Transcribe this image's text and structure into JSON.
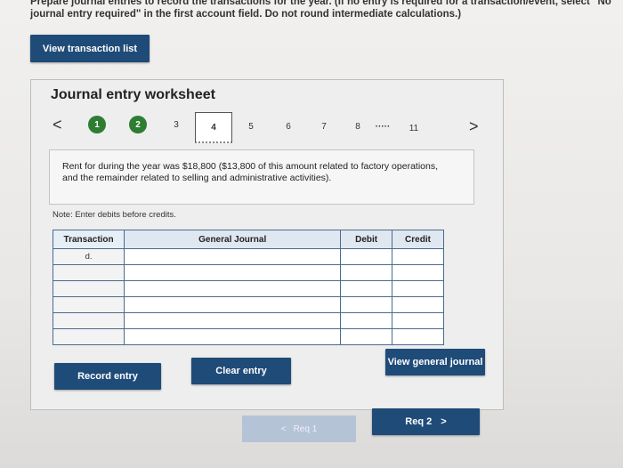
{
  "instructions": "Prepare journal entries to record the transactions for the year. (If no entry is required for a transaction/event, select \"No journal entry required\" in the first account field. Do not round intermediate calculations.)",
  "view_transaction_list": "View transaction list",
  "worksheet": {
    "title": "Journal entry worksheet",
    "prev_arrow": "<",
    "next_arrow": ">",
    "steps": [
      "1",
      "2",
      "3",
      "4",
      "5",
      "6",
      "7",
      "8",
      "·····",
      "11"
    ],
    "completed_steps": [
      "1",
      "2"
    ],
    "current_step": "4",
    "description": "Rent for during the year was $18,800 ($13,800 of this amount related to factory operations, and the remainder related to selling and administrative activities).",
    "note": "Note: Enter debits before credits."
  },
  "table": {
    "headers": {
      "transaction": "Transaction",
      "general_journal": "General Journal",
      "debit": "Debit",
      "credit": "Credit"
    },
    "rows": [
      {
        "transaction": "d.",
        "account": "",
        "debit": "",
        "credit": ""
      },
      {
        "transaction": "",
        "account": "",
        "debit": "",
        "credit": ""
      },
      {
        "transaction": "",
        "account": "",
        "debit": "",
        "credit": ""
      },
      {
        "transaction": "",
        "account": "",
        "debit": "",
        "credit": ""
      },
      {
        "transaction": "",
        "account": "",
        "debit": "",
        "credit": ""
      },
      {
        "transaction": "",
        "account": "",
        "debit": "",
        "credit": ""
      }
    ]
  },
  "buttons": {
    "record_entry": "Record entry",
    "clear_entry": "Clear entry",
    "view_general_journal": "View general journal",
    "req1": "Req 1",
    "req2": "Req 2",
    "req1_arrow": "<",
    "req2_arrow": ">"
  },
  "colors": {
    "navy": "#1f4b78",
    "step_done": "#2e7d32",
    "table_border": "#4a6b8f"
  }
}
